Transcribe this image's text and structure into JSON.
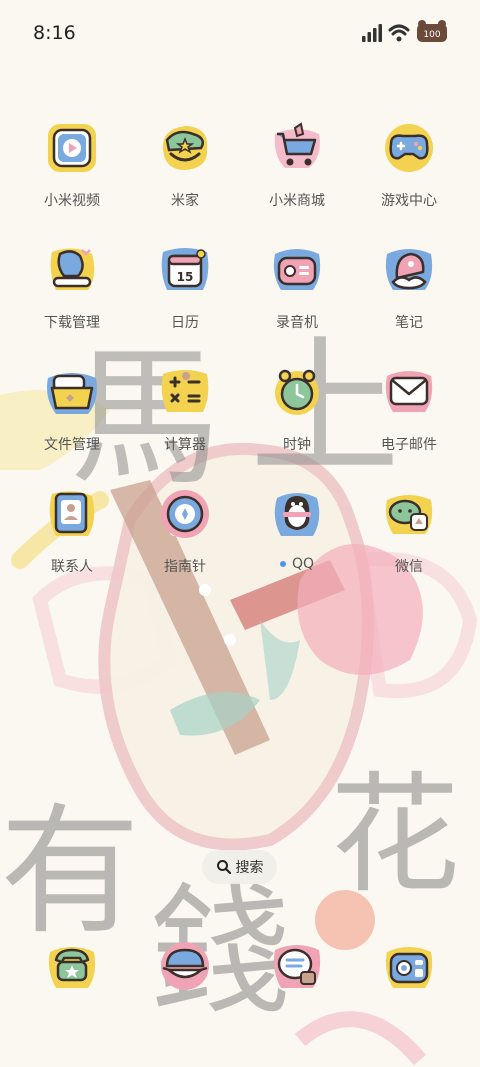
{
  "status_bar": {
    "time": "8:16",
    "icons": [
      "signal-icon",
      "wifi-icon",
      "battery-icon"
    ],
    "battery_text": "100"
  },
  "home_apps": [
    {
      "label": "小米视频",
      "icon": "video-icon"
    },
    {
      "label": "米家",
      "icon": "mijia-icon"
    },
    {
      "label": "小米商城",
      "icon": "shopping-cart-icon"
    },
    {
      "label": "游戏中心",
      "icon": "gamepad-icon"
    },
    {
      "label": "下载管理",
      "icon": "download-icon"
    },
    {
      "label": "日历",
      "icon": "calendar-icon",
      "badge": "15"
    },
    {
      "label": "录音机",
      "icon": "recorder-icon"
    },
    {
      "label": "笔记",
      "icon": "notes-icon"
    },
    {
      "label": "文件管理",
      "icon": "folder-icon"
    },
    {
      "label": "计算器",
      "icon": "calculator-icon"
    },
    {
      "label": "时钟",
      "icon": "clock-icon"
    },
    {
      "label": "电子邮件",
      "icon": "mail-icon"
    },
    {
      "label": "联系人",
      "icon": "contacts-icon"
    },
    {
      "label": "指南针",
      "icon": "compass-icon"
    },
    {
      "label": "QQ",
      "icon": "qq-penguin-icon",
      "new_indicator": true
    },
    {
      "label": "微信",
      "icon": "wechat-icon"
    }
  ],
  "search": {
    "label": "搜索",
    "icon": "search-icon"
  },
  "dock": [
    {
      "icon": "phone-icon"
    },
    {
      "icon": "messages-icon"
    },
    {
      "icon": "browser-icon"
    },
    {
      "icon": "camera-icon"
    }
  ],
  "wallpaper": {
    "texts": [
      "馬上",
      "有錢",
      "花"
    ],
    "colors": {
      "background": "#fbf8f1",
      "accent_pink": "#f0a3b4",
      "accent_yellow": "#f2d24e",
      "accent_blue": "#7aa9e0"
    }
  }
}
